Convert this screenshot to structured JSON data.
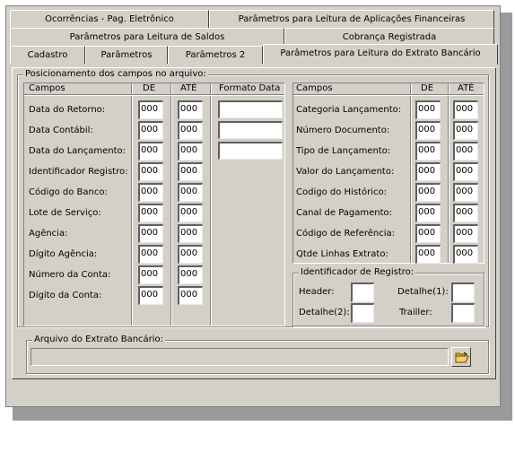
{
  "tabs": {
    "row1": [
      "Ocorrências - Pag. Eletrônico",
      "Parâmetros para Leitura de Aplicações Financeiras"
    ],
    "row2": [
      "Parâmetros para Leitura de Saldos",
      "Cobrança Registrada"
    ],
    "row3": [
      "Cadastro",
      "Parâmetros",
      "Parâmetros 2",
      "Parâmetros para Leitura do Extrato Bancário"
    ]
  },
  "positioning": {
    "title": "Posicionamento dos campos no arquivo:",
    "left": {
      "headers": {
        "campos": "Campos",
        "de": "DE",
        "ate": "ATÉ",
        "formato": "Formato Data"
      },
      "rows": [
        {
          "label": "Data do Retorno:",
          "de": "000",
          "ate": "000"
        },
        {
          "label": "Data Contábil:",
          "de": "000",
          "ate": "000"
        },
        {
          "label": "Data do Lançamento:",
          "de": "000",
          "ate": "000"
        },
        {
          "label": "Identificador Registro:",
          "de": "000",
          "ate": "000"
        },
        {
          "label": "Código do Banco:",
          "de": "000",
          "ate": "000"
        },
        {
          "label": "Lote de Serviço:",
          "de": "000",
          "ate": "000"
        },
        {
          "label": "Agência:",
          "de": "000",
          "ate": "000"
        },
        {
          "label": "Dígito Agência:",
          "de": "000",
          "ate": "000"
        },
        {
          "label": "Número da Conta:",
          "de": "000",
          "ate": "000"
        },
        {
          "label": "Dígito da Conta:",
          "de": "000",
          "ate": "000"
        }
      ],
      "formato_values": [
        "",
        "",
        ""
      ]
    },
    "right": {
      "headers": {
        "campos": "Campos",
        "de": "DE",
        "ate": "ATÉ"
      },
      "rows": [
        {
          "label": "Categoria Lançamento:",
          "de": "000",
          "ate": "000"
        },
        {
          "label": "Número Documento:",
          "de": "000",
          "ate": "000"
        },
        {
          "label": "Tipo de Lançamento:",
          "de": "000",
          "ate": "000"
        },
        {
          "label": "Valor do Lançamento:",
          "de": "000",
          "ate": "000"
        },
        {
          "label": "Codigo do Histórico:",
          "de": "000",
          "ate": "000"
        },
        {
          "label": "Canal de Pagamento:",
          "de": "000",
          "ate": "000"
        },
        {
          "label": "Código de Referência:",
          "de": "000",
          "ate": "000"
        },
        {
          "label": "Qtde Linhas Extrato:",
          "de": "000",
          "ate": "000"
        }
      ]
    },
    "identificador": {
      "title": "Identificador de Registro:",
      "header": "Header:",
      "detalhe1": "Detalhe(1):",
      "detalhe2": "Detalhe(2):",
      "trailler": "Trailler:",
      "values": {
        "header": "",
        "detalhe1": "",
        "detalhe2": "",
        "trailler": ""
      }
    }
  },
  "arquivo": {
    "title": "Arquivo do Extrato Bancário:",
    "value": "",
    "button_icon": "folder-open-icon"
  }
}
